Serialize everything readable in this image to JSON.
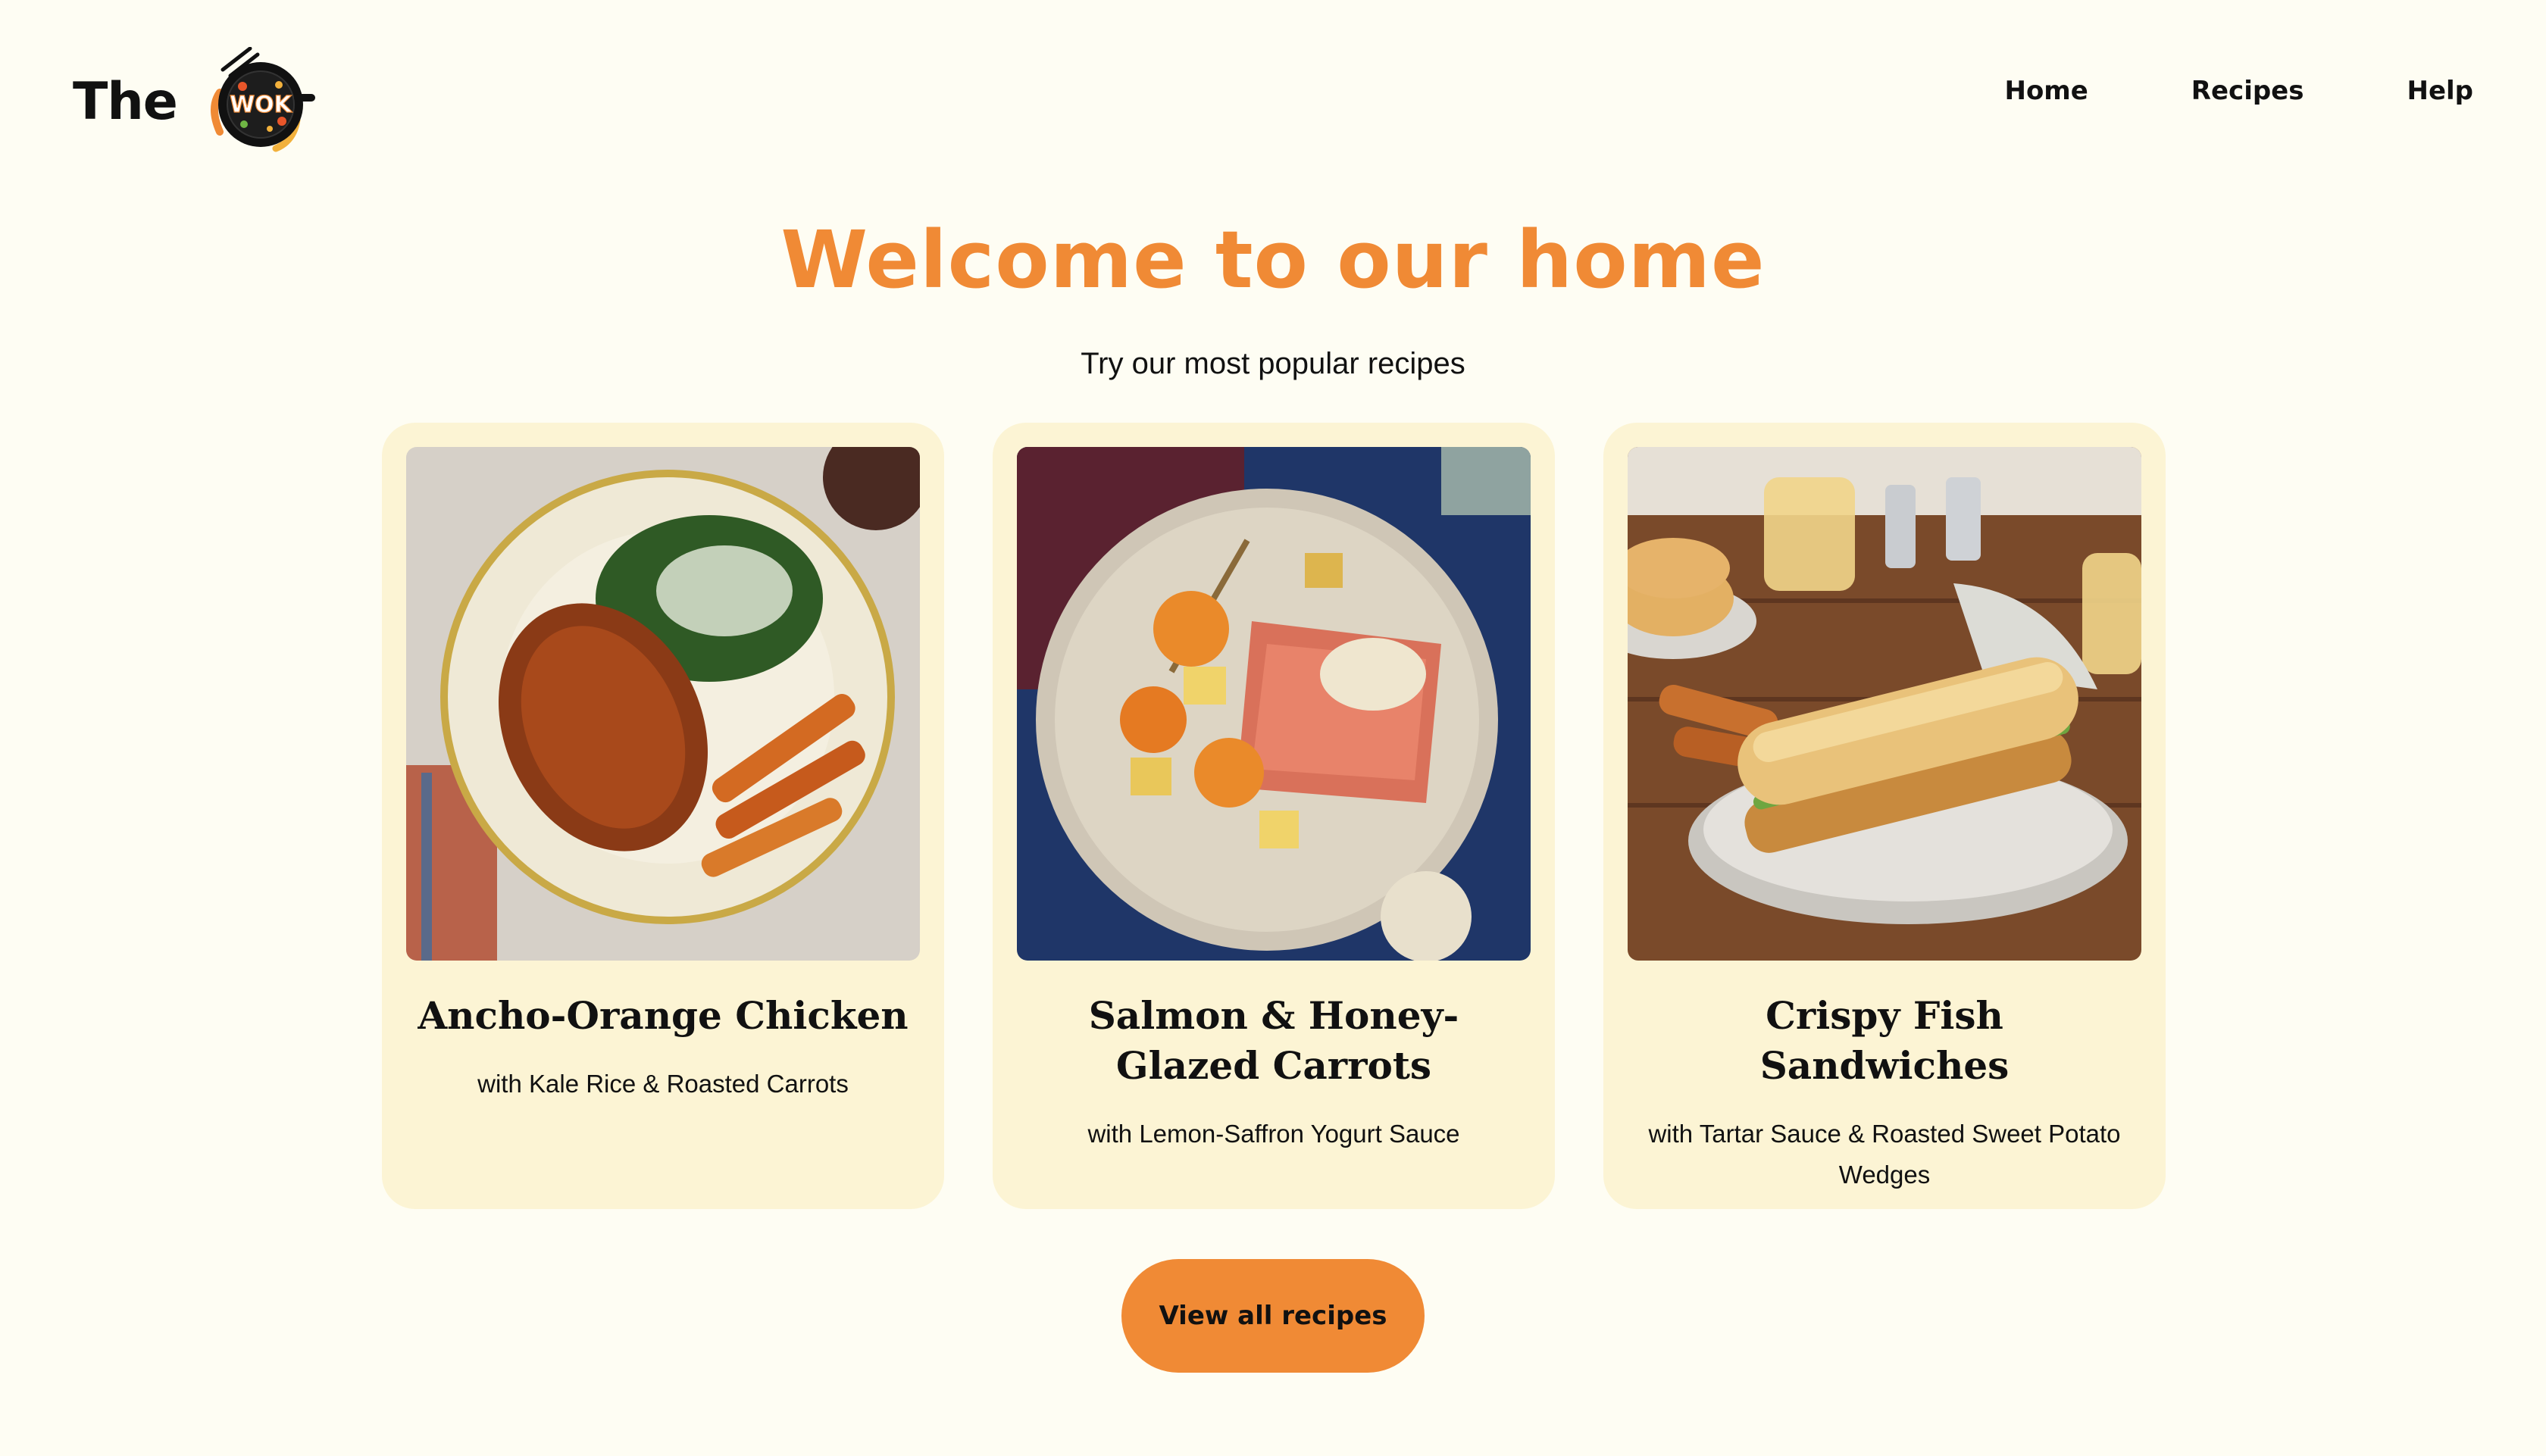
{
  "header": {
    "logo_text": "The",
    "logo_badge_text": "WOK",
    "nav": [
      {
        "label": "Home"
      },
      {
        "label": "Recipes"
      },
      {
        "label": "Help"
      }
    ]
  },
  "hero": {
    "title": "Welcome to our home",
    "subtitle": "Try our most popular recipes"
  },
  "recipes": [
    {
      "title": "Ancho-Orange Chicken",
      "description": "with Kale Rice & Roasted Carrots"
    },
    {
      "title": "Salmon & Honey-Glazed Carrots",
      "description": "with Lemon-Saffron Yogurt Sauce"
    },
    {
      "title": "Crispy Fish Sandwiches",
      "description": "with Tartar Sauce & Roasted Sweet Potato Wedges"
    }
  ],
  "cta": {
    "label": "View all recipes"
  },
  "colors": {
    "background": "#fefdf3",
    "accent": "#f08a35",
    "card": "#fcf4d4",
    "text": "#111111"
  }
}
